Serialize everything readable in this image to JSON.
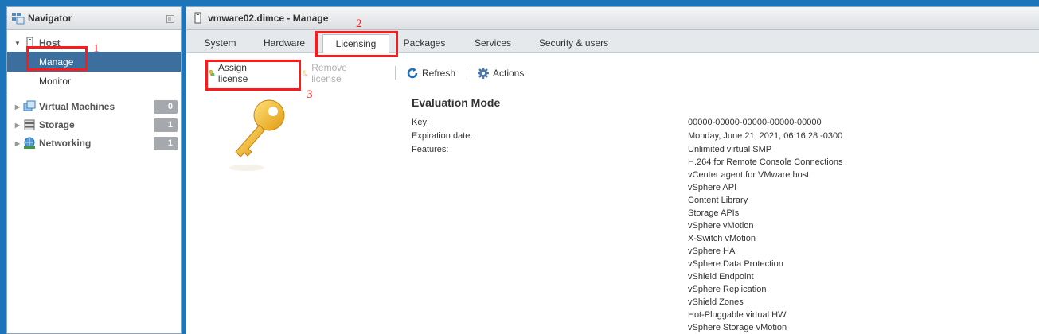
{
  "navigator": {
    "title": "Navigator",
    "items": [
      {
        "label": "Host"
      },
      {
        "label": "Manage"
      },
      {
        "label": "Monitor"
      },
      {
        "label": "Virtual Machines",
        "count": "0"
      },
      {
        "label": "Storage",
        "count": "1"
      },
      {
        "label": "Networking",
        "count": "1"
      }
    ]
  },
  "main": {
    "title": "vmware02.dimce - Manage",
    "tabs": [
      {
        "label": "System"
      },
      {
        "label": "Hardware"
      },
      {
        "label": "Licensing"
      },
      {
        "label": "Packages"
      },
      {
        "label": "Services"
      },
      {
        "label": "Security & users"
      }
    ],
    "toolbar": {
      "assign": "Assign license",
      "remove": "Remove license",
      "refresh": "Refresh",
      "actions": "Actions"
    },
    "license": {
      "title": "Evaluation Mode",
      "key_label": "Key:",
      "key_value": "00000-00000-00000-00000-00000",
      "expiration_label": "Expiration date:",
      "expiration_value": "Monday, June 21, 2021, 06:16:28 -0300",
      "features_label": "Features:",
      "features": [
        "Unlimited virtual SMP",
        "H.264 for Remote Console Connections",
        "vCenter agent for VMware host",
        "vSphere API",
        "Content Library",
        "Storage APIs",
        "vSphere vMotion",
        "X-Switch vMotion",
        "vSphere HA",
        "vSphere Data Protection",
        "vShield Endpoint",
        "vSphere Replication",
        "vShield Zones",
        "Hot-Pluggable virtual HW",
        "vSphere Storage vMotion"
      ]
    }
  },
  "annotations": {
    "step1": "1",
    "step2": "2",
    "step3": "3"
  },
  "colors": {
    "background": "#1e74b8",
    "selected": "#3c6f9e",
    "annotation": "#ff1a1a"
  }
}
